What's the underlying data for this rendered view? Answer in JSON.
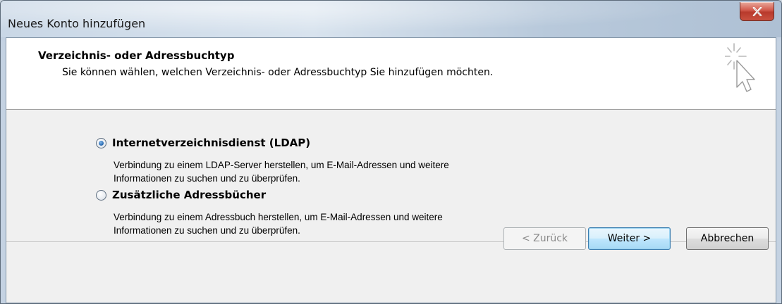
{
  "window": {
    "title": "Neues Konto hinzufügen",
    "close_icon": "close-icon"
  },
  "header": {
    "title": "Verzeichnis- oder Adressbuchtyp",
    "subtitle": "Sie können wählen, welchen Verzeichnis- oder Adressbuchtyp Sie hinzufügen möchten.",
    "icon": "wizard-cursor-icon"
  },
  "options": [
    {
      "label": "Internetverzeichnisdienst (LDAP)",
      "selected": true,
      "description_line1": "Verbindung zu einem LDAP-Server herstellen, um E-Mail-Adressen und weitere",
      "description_line2": "Informationen zu suchen und zu überprüfen."
    },
    {
      "label": "Zusätzliche Adressbücher",
      "selected": false,
      "description_line1": "Verbindung zu einem Adressbuch herstellen, um E-Mail-Adressen und weitere",
      "description_line2": "Informationen zu suchen und zu überprüfen."
    }
  ],
  "buttons": {
    "back": "< Zurück",
    "next": "Weiter >",
    "cancel": "Abbrechen"
  },
  "colors": {
    "close_button": "#c9503f",
    "default_button_border": "#3c7fb1",
    "radio_dot": "#2d6fb5"
  }
}
